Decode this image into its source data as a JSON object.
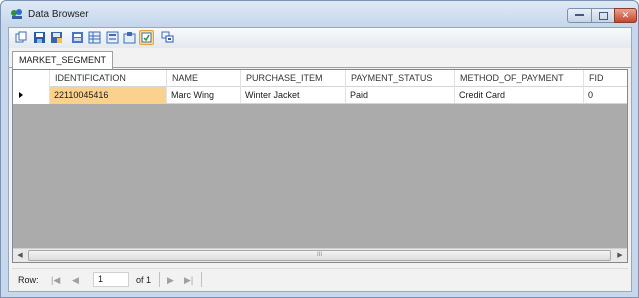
{
  "window": {
    "title": "Data Browser"
  },
  "toolbar": {
    "buttons": [
      "copy-icon",
      "save-icon",
      "save-as-icon",
      "filter-icon",
      "grid-view-icon",
      "form-view-icon",
      "columns-icon",
      "refresh-icon",
      "chart-icon"
    ]
  },
  "tabs": [
    {
      "label": "MARKET_SEGMENT",
      "active": true
    }
  ],
  "grid": {
    "columns": [
      "IDENTIFICATION",
      "NAME",
      "PURCHASE_ITEM",
      "PAYMENT_STATUS",
      "METHOD_OF_PAYMENT",
      "FID"
    ],
    "rows": [
      {
        "cells": [
          "22110045416",
          "Marc Wing",
          "Winter Jacket",
          "Paid",
          "Credit Card",
          "0"
        ]
      }
    ]
  },
  "navigator": {
    "row_label": "Row:",
    "position": "1",
    "of_label": "of 1"
  },
  "colors": {
    "selected_cell": "#fbd28d",
    "empty_grid": "#ababab",
    "titlebar": "#c5d6ec"
  }
}
